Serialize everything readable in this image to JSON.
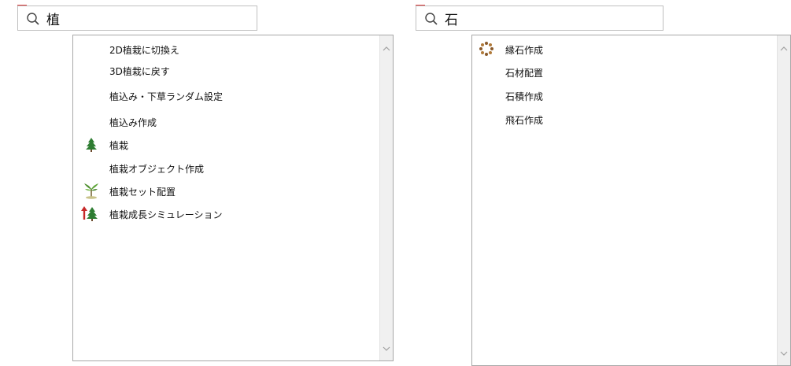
{
  "left_panel": {
    "search_value": "植",
    "items": [
      {
        "label": "2D植栽に切換え",
        "icon": ""
      },
      {
        "label": "3D植栽に戻す",
        "icon": ""
      },
      {
        "label": "植込み・下草ランダム設定",
        "icon": ""
      },
      {
        "label": "植込み作成",
        "icon": ""
      },
      {
        "label": "植栽",
        "icon": "tree-icon"
      },
      {
        "label": "植栽オブジェクト作成",
        "icon": ""
      },
      {
        "label": "植栽セット配置",
        "icon": "plant-set-icon"
      },
      {
        "label": "植栽成長シミュレーション",
        "icon": "growth-simulation-icon"
      }
    ]
  },
  "right_panel": {
    "search_value": "石",
    "items": [
      {
        "label": "縁石作成",
        "icon": "stone-ring-icon"
      },
      {
        "label": "石材配置",
        "icon": ""
      },
      {
        "label": "石積作成",
        "icon": ""
      },
      {
        "label": "飛石作成",
        "icon": ""
      }
    ]
  },
  "colors": {
    "close": "#d83b3b",
    "list_border": "#a8a8a8",
    "scrollbar": "#f0f0f0",
    "tree_green": "#2e7d32",
    "growth_arrow": "#c62828",
    "stone_brown": "#8a5a2b"
  }
}
